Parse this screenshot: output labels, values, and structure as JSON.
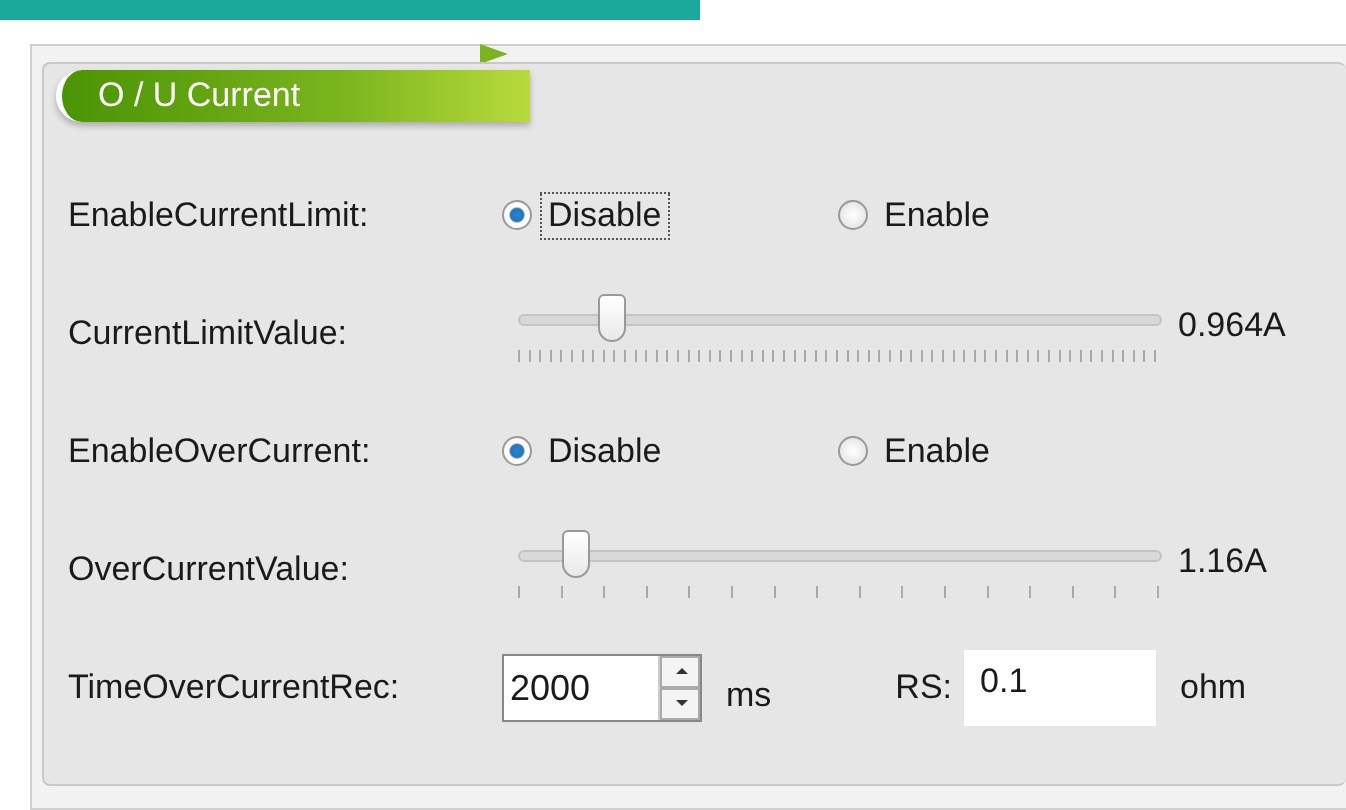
{
  "group": {
    "title": "O / U Current"
  },
  "rows": [
    {
      "kind": "radio",
      "label": "EnableCurrentLimit:",
      "options": [
        {
          "label": "Disable",
          "selected": true,
          "focused": true
        },
        {
          "label": "Enable",
          "selected": false,
          "focused": false
        }
      ]
    },
    {
      "kind": "slider",
      "label": "CurrentLimitValue:",
      "level": 0.125,
      "dense_ticks": true,
      "reading": "0.964A"
    },
    {
      "kind": "radio",
      "label": "EnableOverCurrent:",
      "options": [
        {
          "label": "Disable",
          "selected": true,
          "focused": false
        },
        {
          "label": "Enable",
          "selected": false,
          "focused": false
        }
      ]
    },
    {
      "kind": "slider",
      "label": "OverCurrentValue:",
      "level": 0.07,
      "dense_ticks": false,
      "reading": "1.16A"
    },
    {
      "kind": "fields",
      "label": "TimeOverCurrentRec:",
      "spin_value": "2000",
      "spin_unit": "ms",
      "rs_label": "RS:",
      "rs_value": "0.1",
      "rs_unit": "ohm"
    }
  ]
}
